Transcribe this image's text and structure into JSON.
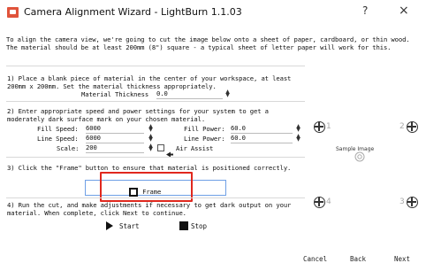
{
  "window": {
    "title": "Camera Alignment Wizard - LightBurn 1.1.03",
    "help_label": "?",
    "close_label": "×"
  },
  "intro": {
    "line1": "To align the camera view, we're going to cut the image below onto a sheet of paper, cardboard, or thin wood.",
    "line2": "The material should be at least 200mm (8\") square - a typical sheet of letter paper will work for this."
  },
  "step1": {
    "line1": "1) Place a blank piece of material in the center of your workspace, at least",
    "line2": "200mm x 200mm. Set the material thickness appropriately.",
    "thickness_label": "Material Thickness",
    "thickness_value": "0.0"
  },
  "step2": {
    "line1": "2) Enter appropriate speed and power settings for your system to get a",
    "line2": "moderately dark surface mark on your chosen material.",
    "fill_speed_label": "Fill Speed:",
    "fill_speed_value": "6000",
    "fill_power_label": "Fill Power:",
    "fill_power_value": "60.0",
    "line_speed_label": "Line Speed:",
    "line_speed_value": "6000",
    "line_power_label": "Line Power:",
    "line_power_value": "60.0",
    "scale_label": "Scale:",
    "scale_value": "200",
    "air_assist_label": "Air Assist"
  },
  "step3": {
    "line1": "3) Click the \"Frame\" button to ensure that material is positioned correctly.",
    "frame_label": "Frame"
  },
  "step4": {
    "line1": "4) Run the cut, and make adjustments if necessary to get dark output on your",
    "line2": "material. When complete, click Next to continue.",
    "start_label": "Start",
    "stop_label": "Stop"
  },
  "preview": {
    "marker1": "1",
    "marker2": "2",
    "marker3": "3",
    "marker4": "4",
    "sample_label": "Sample Image"
  },
  "footer": {
    "cancel_label": "Cancel",
    "back_label": "Back",
    "next_label": "Next"
  },
  "colors": {
    "highlight": "#e0281e",
    "frame_border": "#6fa0e6",
    "app_icon": "#e0533b"
  }
}
